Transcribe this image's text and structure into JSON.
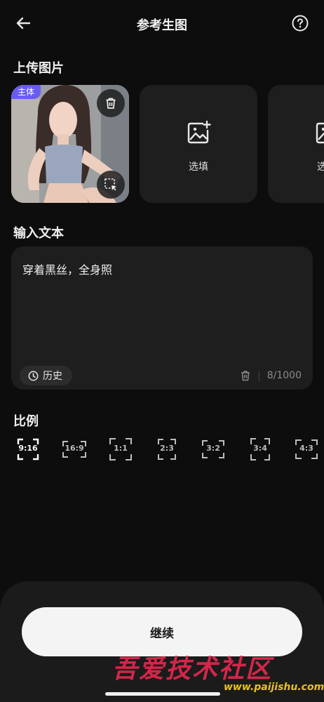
{
  "header": {
    "title": "参考生图"
  },
  "upload": {
    "section_title": "上传图片",
    "main_tag": "主体",
    "optional_label_1": "选填",
    "optional_label_2": "选填"
  },
  "text_input": {
    "section_title": "输入文本",
    "value": "穿着黑丝，全身照",
    "history_label": "历史",
    "counter": "8/1000"
  },
  "ratio": {
    "section_title": "比例",
    "options": [
      "9:16",
      "16:9",
      "1:1",
      "2:3",
      "3:2",
      "3:4",
      "4:3"
    ],
    "selected": "9:16"
  },
  "footer": {
    "continue_label": "继续"
  },
  "watermark": {
    "text": "吾爱技术社区",
    "url": "www.paijishu.com"
  },
  "colors": {
    "background": "#0d0d0d",
    "card": "#1e1e1e",
    "tag": "#6a5cf0",
    "button": "#f4f4f4"
  }
}
